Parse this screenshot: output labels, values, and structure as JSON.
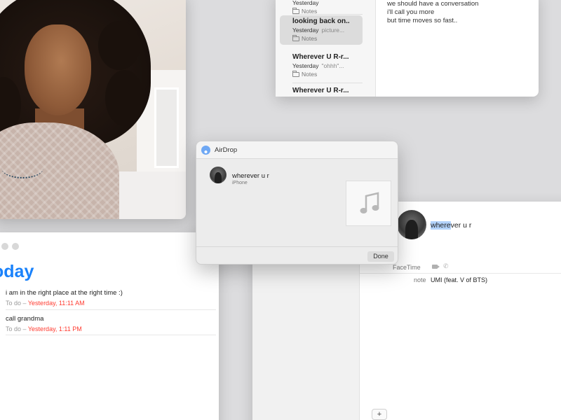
{
  "notes": {
    "items": [
      {
        "title": "",
        "date": "Yesterday",
        "snippet": "",
        "folder": "Notes"
      },
      {
        "title": "looking back on...",
        "date": "Yesterday",
        "snippet": "picture...",
        "folder": "Notes"
      },
      {
        "title": "Wherever U R-r...",
        "date": "Yesterday",
        "snippet": "\"ohhh\"...",
        "folder": "Notes"
      },
      {
        "title": "Wherever U R-r...",
        "date": "",
        "snippet": "",
        "folder": ""
      }
    ],
    "body_lines": [
      "we should have a conversation",
      "i'll call you more",
      "but time moves so fast.."
    ]
  },
  "reminders": {
    "title": "oday",
    "items": [
      {
        "text": "i am in the right place at the right time :)",
        "list": "To do",
        "sep": " – ",
        "date": "Yesterday, 11:11 AM"
      },
      {
        "text": "call grandma",
        "list": "To do",
        "sep": " – ",
        "date": "Yesterday, 1:11 PM"
      }
    ]
  },
  "airdrop": {
    "title": "AirDrop",
    "contact_name": "wherever u r",
    "device": "iPhone",
    "done_label": "Done"
  },
  "contact": {
    "name_highlight": "where",
    "name_rest": "ver u r",
    "facetime_label": "FaceTime",
    "note_label": "note",
    "note_value": "UMI (feat. V of BTS)",
    "add_label": "+"
  },
  "colors": {
    "accent_blue": "#1a82fb",
    "date_red": "#ff3b30",
    "selection": "#b3d3fb"
  },
  "icons": {
    "folder": "folder-icon",
    "airdrop": "airdrop-icon",
    "music": "music-note-icon",
    "video": "video-camera-icon",
    "phone": "phone-icon"
  }
}
